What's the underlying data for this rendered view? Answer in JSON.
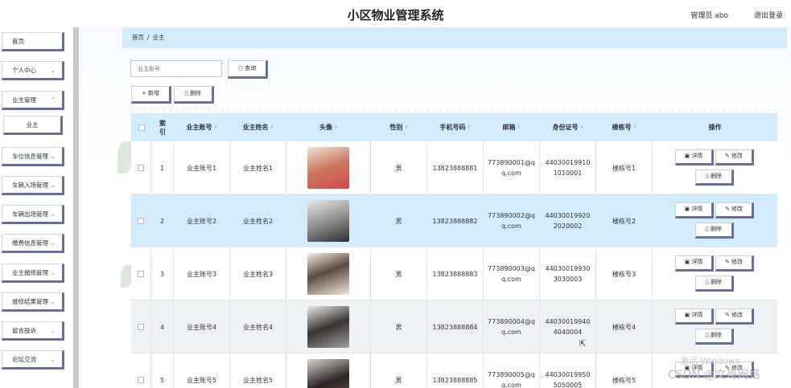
{
  "header": {
    "title": "小区物业管理系统",
    "user_label": "管理员 abo",
    "logout_label": "退出登录"
  },
  "sidebar": {
    "items": [
      {
        "label": "首页"
      },
      {
        "label": "个人中心"
      },
      {
        "label": "业主管理"
      },
      {
        "label": "业主"
      },
      {
        "label": "车位信息管理"
      },
      {
        "label": "车辆入场管理"
      },
      {
        "label": "车辆出场管理"
      },
      {
        "label": "缴费信息管理"
      },
      {
        "label": "业主报修管理"
      },
      {
        "label": "维修结果管理"
      },
      {
        "label": "留言投诉"
      },
      {
        "label": "论坛交流"
      }
    ]
  },
  "breadcrumb": {
    "home": "首页",
    "sep": "/",
    "current": "业主"
  },
  "search": {
    "placeholder": "业主账号",
    "button_label": "查询"
  },
  "toolbar": {
    "add_label": "+ 新增",
    "delete_label": "删除"
  },
  "table": {
    "headers": {
      "index": "索引",
      "account": "业主账号",
      "name": "业主姓名",
      "avatar": "头像",
      "gender": "性别",
      "phone": "手机号码",
      "email": "邮箱",
      "id_card": "身份证号",
      "building": "楼栋号",
      "actions": "操作"
    },
    "action_labels": {
      "detail": "详情",
      "edit": "修改",
      "delete": "删除"
    },
    "rows": [
      {
        "index": "1",
        "account": "业主账号1",
        "name": "业主姓名1",
        "gender": "男",
        "phone": "13823888881",
        "email_1": "773890001@q",
        "email_2": "q.com",
        "id_1": "44030019910",
        "id_2": "1010001",
        "building": "楼栋号1"
      },
      {
        "index": "2",
        "account": "业主账号2",
        "name": "业主姓名2",
        "gender": "男",
        "phone": "13823888882",
        "email_1": "773890002@q",
        "email_2": "q.com",
        "id_1": "44030019920",
        "id_2": "2020002",
        "building": "楼栋号2"
      },
      {
        "index": "3",
        "account": "业主账号3",
        "name": "业主姓名3",
        "gender": "男",
        "phone": "13823888883",
        "email_1": "773890003@q",
        "email_2": "q.com",
        "id_1": "44030019930",
        "id_2": "3030003",
        "building": "楼栋号3"
      },
      {
        "index": "4",
        "account": "业主账号4",
        "name": "业主姓名4",
        "gender": "男",
        "phone": "13823888884",
        "email_1": "773890004@q",
        "email_2": "q.com",
        "id_1": "44030019940",
        "id_2": "4040004",
        "building": "楼栋号4"
      },
      {
        "index": "5",
        "account": "业主账号5",
        "name": "业主姓名5",
        "gender": "男",
        "phone": "13823888885",
        "email_1": "773890005@q",
        "email_2": "q.com",
        "id_1": "44030019950",
        "id_2": "5050005",
        "building": "楼栋号5"
      }
    ]
  },
  "watermark": {
    "activate": "激活 Windows",
    "csdn": "CSDN @文哥网络"
  },
  "colors": {
    "accent_blue": "#d3ecfb",
    "button_shadow": "#6a6f9c"
  }
}
